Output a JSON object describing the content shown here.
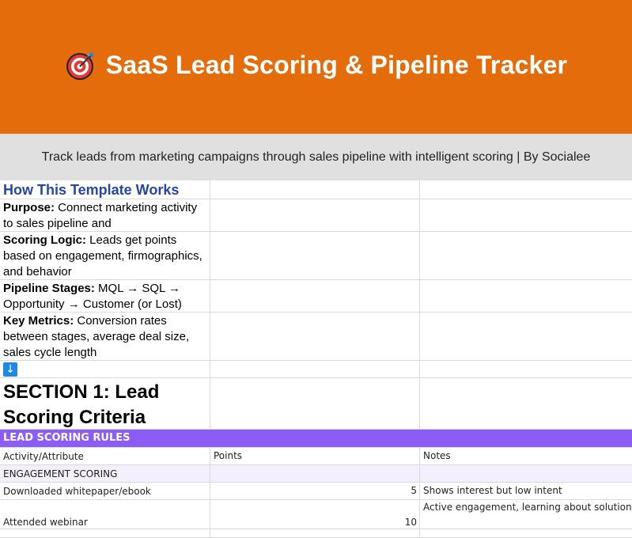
{
  "banner": {
    "icon": "target-dart-icon",
    "title": "SaaS Lead Scoring & Pipeline Tracker",
    "background": "#e46c0a"
  },
  "subtitle": "Track leads from marketing campaigns through sales pipeline with intelligent scoring | By Socialee",
  "howto": {
    "heading": "How This Template Works",
    "items": [
      {
        "label": "Purpose:",
        "text": " Connect marketing activity to sales pipeline and"
      },
      {
        "label": "Scoring Logic:",
        "text": " Leads get points based on engagement, firmographics, and behavior"
      },
      {
        "label": "Pipeline Stages:",
        "text": " MQL → SQL → Opportunity → Customer (or Lost)"
      },
      {
        "label": "Key Metrics:",
        "text": " Conversion rates between stages, average deal size, sales cycle length"
      }
    ]
  },
  "arrow": "↓",
  "section1": {
    "title": "SECTION 1: Lead Scoring Criteria"
  },
  "rules": {
    "header": "LEAD SCORING RULES",
    "accent": "#8b5cf6",
    "columns": [
      "Activity/Attribute",
      "Points",
      "Notes"
    ],
    "category": "ENGAGEMENT SCORING",
    "rows": [
      {
        "activity": "Downloaded whitepaper/ebook",
        "points": "5",
        "notes": "Shows interest but low intent"
      },
      {
        "activity": "Attended webinar",
        "points": "10",
        "notes": "Active engagement, learning about solution"
      }
    ]
  }
}
